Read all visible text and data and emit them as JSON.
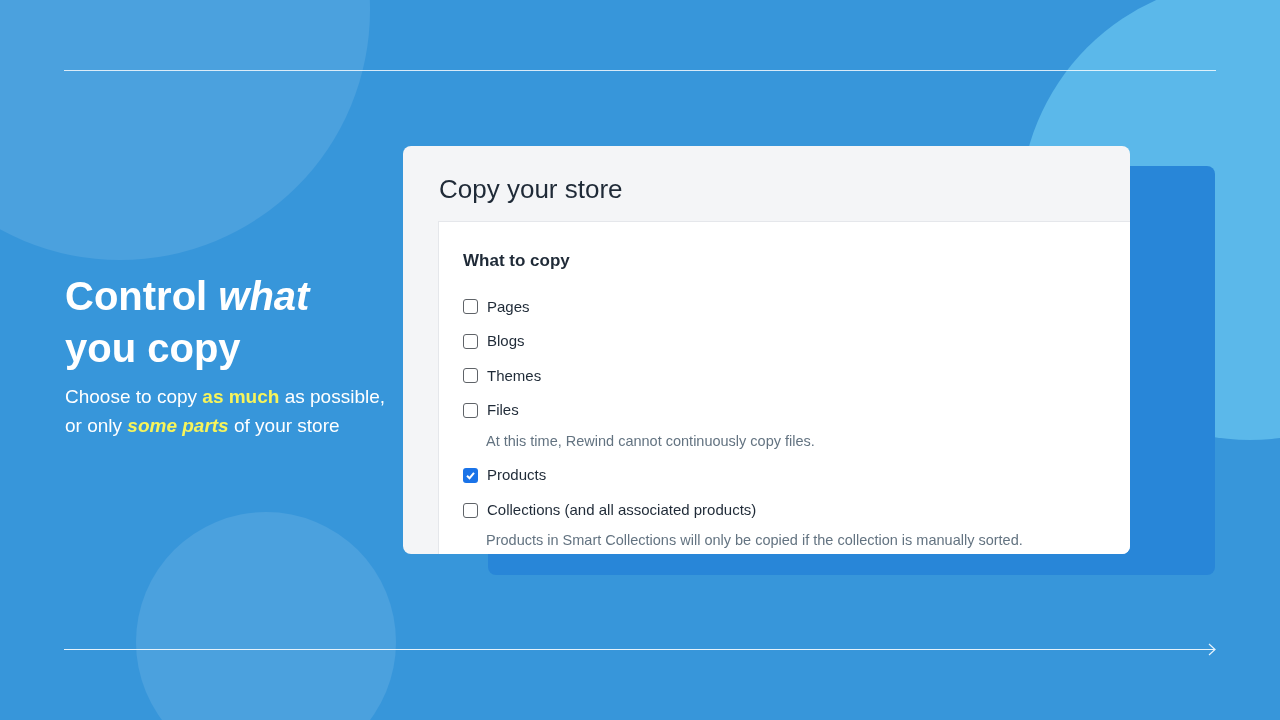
{
  "headline": "Control *what* you copy",
  "subtitle": "Choose to copy **as much** as possible, or only *some parts* of your store",
  "card": {
    "title": "Copy your store",
    "section_title": "What to copy",
    "options": [
      {
        "label": "Pages",
        "checked": false
      },
      {
        "label": "Blogs",
        "checked": false
      },
      {
        "label": "Themes",
        "checked": false
      },
      {
        "label": "Files",
        "checked": false,
        "note": "At this time, Rewind cannot continuously copy files."
      },
      {
        "label": "Products",
        "checked": true
      },
      {
        "label": "Collections (and all associated products)",
        "checked": false,
        "note": "Products in Smart Collections will only be copied if the collection is manually sorted."
      }
    ]
  }
}
